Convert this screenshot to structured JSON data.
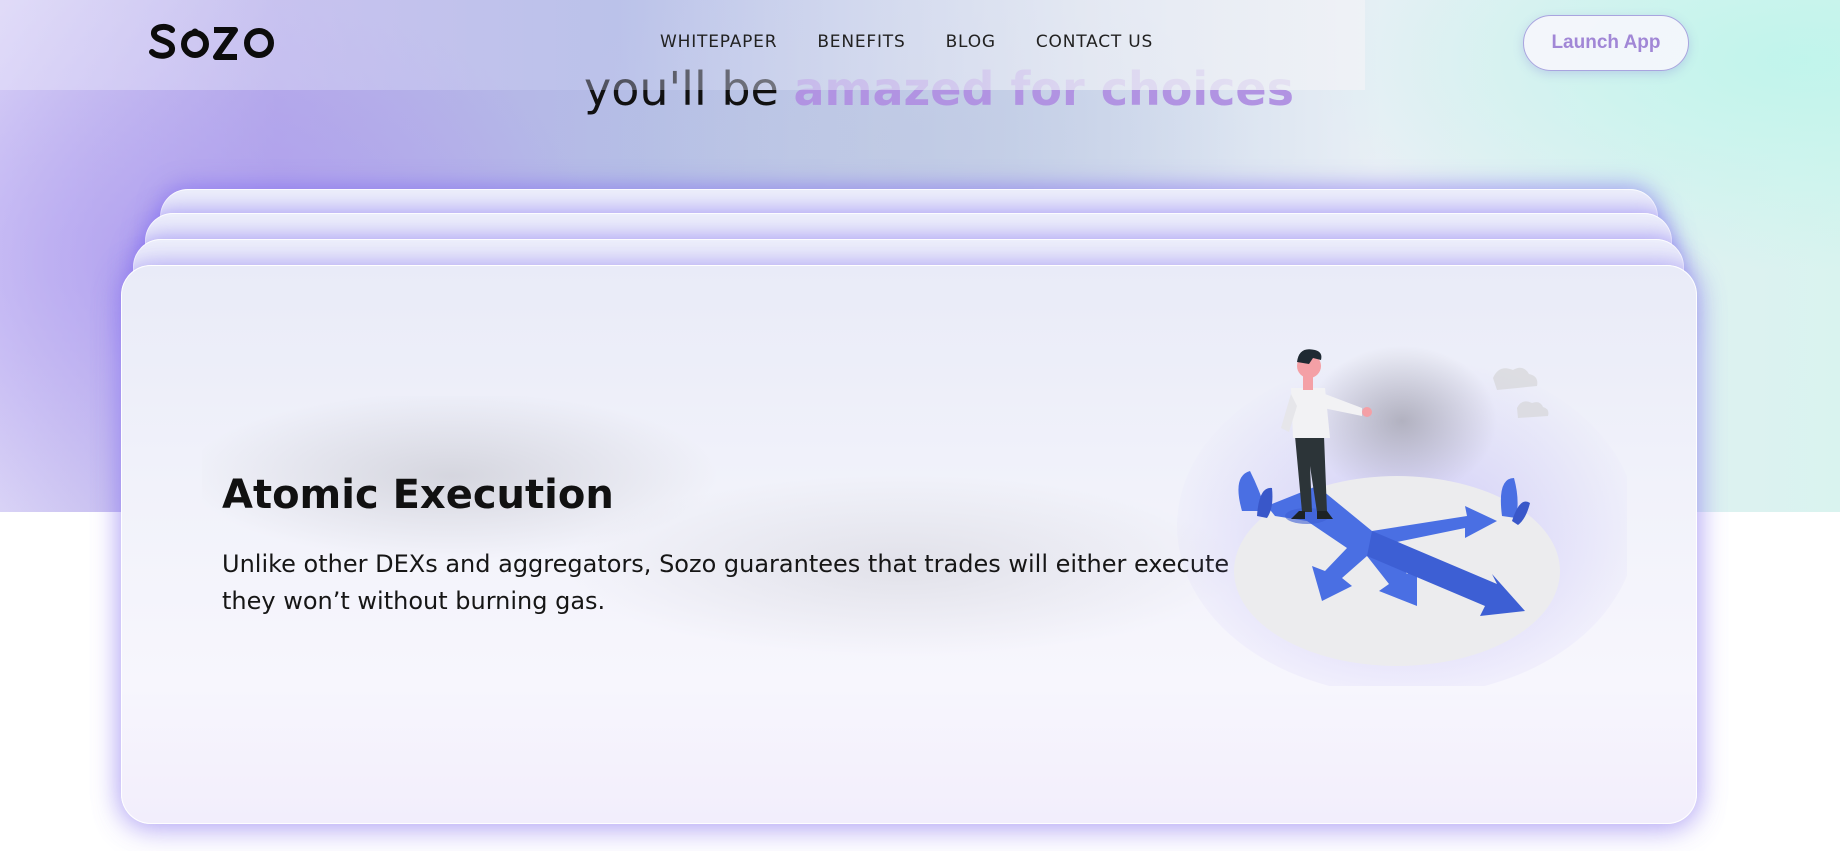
{
  "brand": {
    "logo_text": "SOZO"
  },
  "nav": {
    "items": [
      {
        "label": "WHITEPAPER"
      },
      {
        "label": "BENEFITS"
      },
      {
        "label": "BLOG"
      },
      {
        "label": "CONTACT US"
      }
    ],
    "launch_label": "Launch App"
  },
  "hero": {
    "heading_prefix": "you'll be ",
    "heading_accent": "amazed for choices"
  },
  "feature_card": {
    "title": "Atomic Execution",
    "description": "Unlike other DEXs and aggregators, Sozo guarantees that trades will either execute or they won’t without burning gas.",
    "illustration_icon": "person-at-crossroads-arrows-illustration"
  },
  "colors": {
    "accent": "#b193e2",
    "launch_text": "#a187d6",
    "card_glow": "#7d69f0",
    "arrow_blue": "#4a6fe3"
  }
}
